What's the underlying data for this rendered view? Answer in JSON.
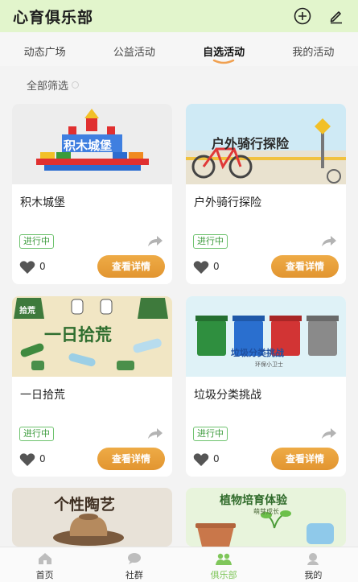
{
  "header": {
    "title": "心育俱乐部"
  },
  "tabs": [
    {
      "label": "动态广场"
    },
    {
      "label": "公益活动"
    },
    {
      "label": "自选活动"
    },
    {
      "label": "我的活动"
    }
  ],
  "filter": {
    "label": "全部筛选"
  },
  "cards": [
    {
      "title": "积木城堡",
      "image_text": "积木城堡",
      "status": "进行中",
      "likes": "0",
      "action": "查看详情"
    },
    {
      "title": "户外骑行探险",
      "image_text": "户外骑行探险",
      "status": "进行中",
      "likes": "0",
      "action": "查看详情"
    },
    {
      "title": "一日拾荒",
      "image_text": "一日拾荒",
      "image_tag": "拾荒",
      "status": "进行中",
      "likes": "0",
      "action": "查看详情"
    },
    {
      "title": "垃圾分类挑战",
      "image_text": "垃圾分类挑战",
      "image_subtext": "环保小卫士",
      "status": "进行中",
      "likes": "0",
      "action": "查看详情"
    },
    {
      "title": "",
      "image_text": "个性陶艺"
    },
    {
      "title": "",
      "image_text": "植物培育体验",
      "image_subtext": "萌芽成长"
    }
  ],
  "bottom_nav": [
    {
      "label": "首页",
      "icon": "home-icon"
    },
    {
      "label": "社群",
      "icon": "chat-icon"
    },
    {
      "label": "俱乐部",
      "icon": "group-icon"
    },
    {
      "label": "我的",
      "icon": "user-icon"
    }
  ],
  "colors": {
    "accent_green": "#7fc65a",
    "header_bg": "#e2f5cc",
    "button_orange": "#e89d38",
    "tab_indicator": "#f0a050"
  }
}
